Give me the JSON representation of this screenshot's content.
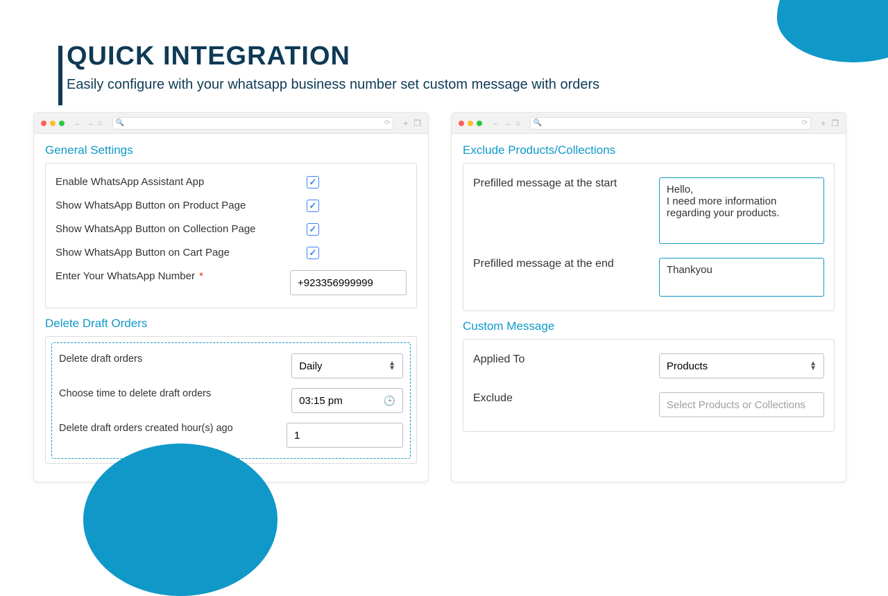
{
  "hero": {
    "title": "QUICK INTEGRATION",
    "subtitle": "Easily configure with your whatsapp business number set custom message with orders"
  },
  "left": {
    "general": {
      "heading": "General Settings",
      "rows": {
        "enable_app": "Enable WhatsApp Assistant App",
        "show_product": "Show WhatsApp Button on Product Page",
        "show_collection": "Show WhatsApp Button on Collection Page",
        "show_cart": "Show WhatsApp Button on Cart Page",
        "enter_number": "Enter Your WhatsApp Number",
        "required_mark": "*",
        "number_value": "+923356999999"
      }
    },
    "delete_drafts": {
      "heading": "Delete Draft Orders",
      "rows": {
        "delete_label": "Delete draft orders",
        "delete_value": "Daily",
        "time_label": "Choose time to delete draft orders",
        "time_value": "03:15 pm",
        "hours_label": "Delete draft orders created hour(s) ago",
        "hours_value": "1"
      }
    }
  },
  "right": {
    "exclude": {
      "heading": "Exclude Products/Collections",
      "start_label": "Prefilled message at the start",
      "start_value": "Hello,\nI need more information regarding your products.",
      "end_label": "Prefilled message at the end",
      "end_value": "Thankyou"
    },
    "custom": {
      "heading": "Custom Message",
      "applied_label": "Applied To",
      "applied_value": "Products",
      "exclude_label": "Exclude",
      "exclude_placeholder": "Select Products or Collections"
    }
  }
}
